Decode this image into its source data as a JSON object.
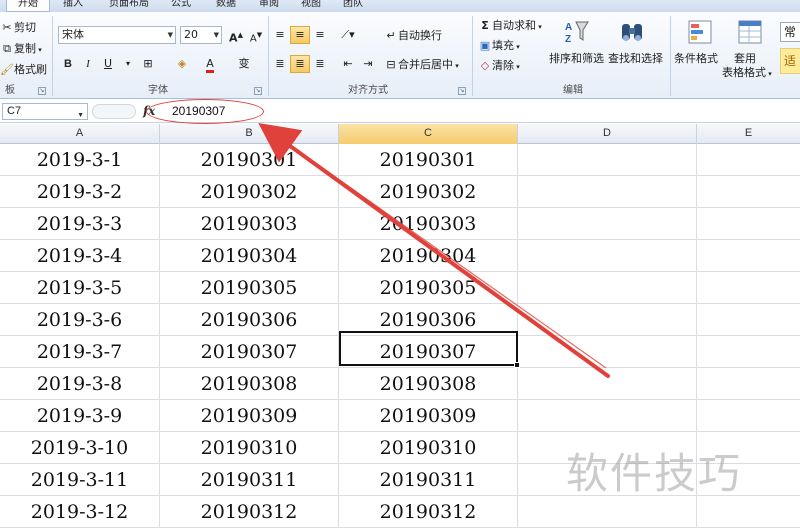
{
  "tabs": [
    {
      "label": "开始",
      "active": true
    },
    {
      "label": "插入",
      "active": false
    },
    {
      "label": "页面布局",
      "active": false
    },
    {
      "label": "公式",
      "active": false
    },
    {
      "label": "数据",
      "active": false
    },
    {
      "label": "审阅",
      "active": false
    },
    {
      "label": "视图",
      "active": false
    },
    {
      "label": "团队",
      "active": false
    }
  ],
  "ribbon": {
    "clipboard": {
      "cut": "剪切",
      "copy": "复制",
      "format_painter": "格式刷",
      "group": "板"
    },
    "font": {
      "name": "宋体",
      "size": "20",
      "grow": "A",
      "shrink": "A",
      "bold": "B",
      "italic": "I",
      "underline": "U",
      "wen": "变",
      "group": "字体"
    },
    "alignment": {
      "wrap": "自动换行",
      "merge": "合并后居中",
      "group": "对齐方式"
    },
    "editing": {
      "autosum": "自动求和",
      "fill": "填充",
      "clear": "清除",
      "sort": "排序和筛选",
      "find": "查找和选择",
      "group": "编辑"
    },
    "styles": {
      "conditional": "条件格式",
      "table_line1": "套用",
      "table_line2": "表格格式",
      "number_format": "常规",
      "cell_style": "适中"
    }
  },
  "formula_bar": {
    "name_box": "C7",
    "fx": "fx",
    "value": "20190307"
  },
  "columns": [
    "A",
    "B",
    "C",
    "D",
    "E"
  ],
  "selected_column": "C",
  "rows": [
    [
      "2019-3-1",
      "20190301",
      "20190301"
    ],
    [
      "2019-3-2",
      "20190302",
      "20190302"
    ],
    [
      "2019-3-3",
      "20190303",
      "20190303"
    ],
    [
      "2019-3-4",
      "20190304",
      "20190304"
    ],
    [
      "2019-3-5",
      "20190305",
      "20190305"
    ],
    [
      "2019-3-6",
      "20190306",
      "20190306"
    ],
    [
      "2019-3-7",
      "20190307",
      "20190307"
    ],
    [
      "2019-3-8",
      "20190308",
      "20190308"
    ],
    [
      "2019-3-9",
      "20190309",
      "20190309"
    ],
    [
      "2019-3-10",
      "20190310",
      "20190310"
    ],
    [
      "2019-3-11",
      "20190311",
      "20190311"
    ],
    [
      "2019-3-12",
      "20190312",
      "20190312"
    ]
  ],
  "selected_cell": "C7",
  "watermark": "软件技巧",
  "colors": {
    "annotation": "#e0423b",
    "selection": "#f5cb6c"
  }
}
